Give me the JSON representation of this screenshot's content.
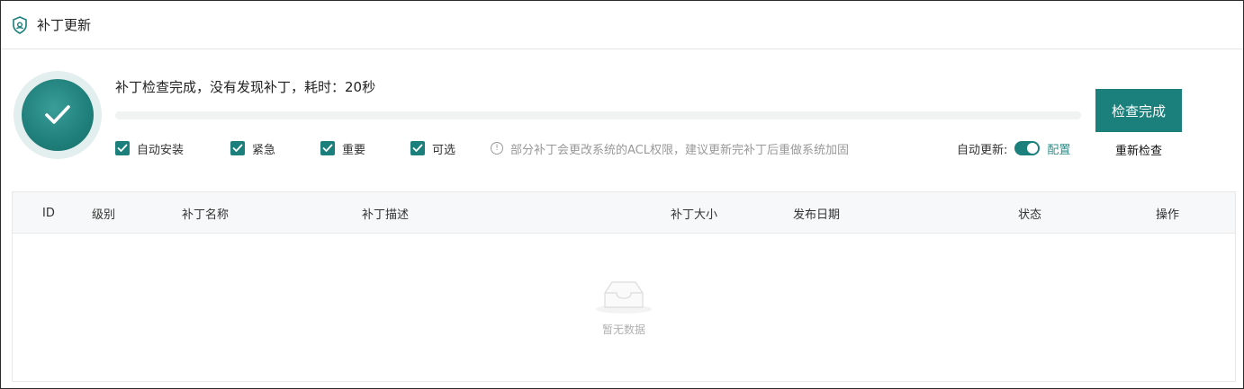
{
  "header": {
    "title": "补丁更新",
    "icon": "shield-icon"
  },
  "status": {
    "message": "补丁检查完成，没有发现补丁，耗时：20秒",
    "progress": 1.0,
    "icon": "checkmark-icon"
  },
  "options": [
    {
      "label": "自动安装",
      "checked": true
    },
    {
      "label": "紧急",
      "checked": true
    },
    {
      "label": "重要",
      "checked": true
    },
    {
      "label": "可选",
      "checked": true
    }
  ],
  "notice": "部分补丁会更改系统的ACL权限，建议更新完补丁后重做系统加固",
  "auto_update": {
    "label": "自动更新:",
    "enabled": true,
    "config_label": "配置"
  },
  "buttons": {
    "primary": "检查完成",
    "recheck": "重新检查"
  },
  "table": {
    "columns": [
      "ID",
      "级别",
      "补丁名称",
      "补丁描述",
      "补丁大小",
      "发布日期",
      "状态",
      "操作"
    ],
    "rows": [],
    "empty_text": "暂无数据"
  },
  "colors": {
    "accent": "#1b7f7b",
    "link": "#2f8f8a",
    "muted": "#999999"
  }
}
